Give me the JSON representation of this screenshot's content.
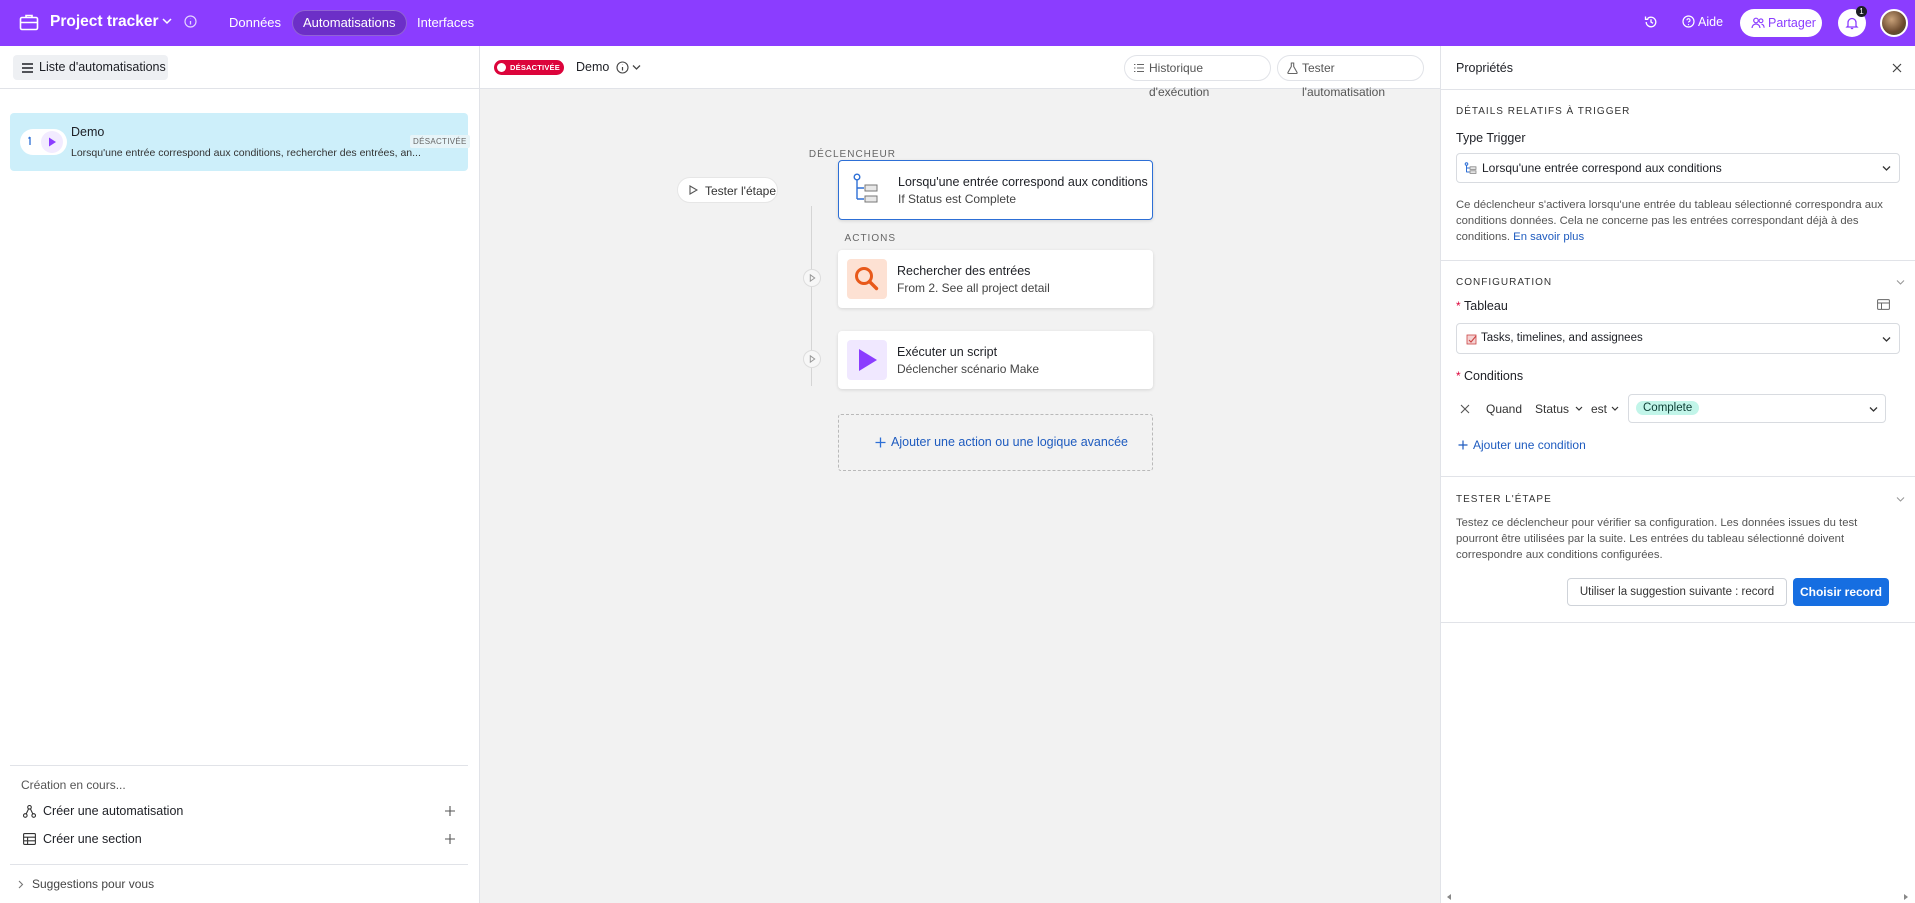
{
  "topbar": {
    "app_title": "Project tracker",
    "nav": [
      "Données",
      "Automatisations",
      "Interfaces"
    ],
    "help_label": "Aide",
    "share_label": "Partager",
    "notif_count": "1",
    "accent": "#8b3dff"
  },
  "left": {
    "list_button": "Liste d'automatisations",
    "automation": {
      "name": "Demo",
      "description": "Lorsqu'une entrée correspond aux conditions, rechercher des entrées, an...",
      "status": "DÉSACTIVÉE"
    },
    "creating_label": "Création en cours...",
    "create_automation": "Créer une automatisation",
    "create_section": "Créer une section",
    "suggestions": "Suggestions pour vous"
  },
  "center": {
    "status_badge": "DÉSACTIVÉE",
    "automation_name": "Demo",
    "history_button": "Historique d'exécution",
    "test_button": "Tester l'automatisation",
    "trigger_label": "DÉCLENCHEUR",
    "test_step_button": "Tester l'étape",
    "actions_label": "ACTIONS",
    "trigger_card": {
      "title": "Lorsqu'une entrée correspond aux conditions",
      "subtitle": "If Status est Complete"
    },
    "action1": {
      "title": "Rechercher des entrées",
      "subtitle": "From 2. See all project detail"
    },
    "action2": {
      "title": "Exécuter un script",
      "subtitle": "Déclencher scénario Make"
    },
    "add_action": "Ajouter une action ou une logique avancée"
  },
  "right": {
    "title": "Propriétés",
    "trigger_section": "DÉTAILS RELATIFS À TRIGGER",
    "trigger_type_label": "Type Trigger",
    "trigger_type_value": "Lorsqu'une entrée correspond aux conditions",
    "trigger_help": "Ce déclencheur s'activera lorsqu'une entrée du tableau sélectionné correspondra aux conditions données. Cela ne concerne pas les entrées correspondant déjà à des conditions.",
    "learn_more": "En savoir plus",
    "config_section": "CONFIGURATION",
    "table_label": "Tableau",
    "table_value": "Tasks, timelines, and assignees",
    "conditions_label": "Conditions",
    "cond_when": "Quand",
    "cond_field": "Status",
    "cond_op": "est",
    "cond_value": "Complete",
    "add_condition": "Ajouter une condition",
    "test_section": "TESTER L'ÉTAPE",
    "test_help": "Testez ce déclencheur pour vérifier sa configuration. Les données issues du test pourront être utilisées par la suite. Les entrées du tableau sélectionné doivent correspondre aux conditions configurées.",
    "use_suggestion": "Utiliser la suggestion suivante : record",
    "choose_record": "Choisir record",
    "required_mark": "*"
  }
}
